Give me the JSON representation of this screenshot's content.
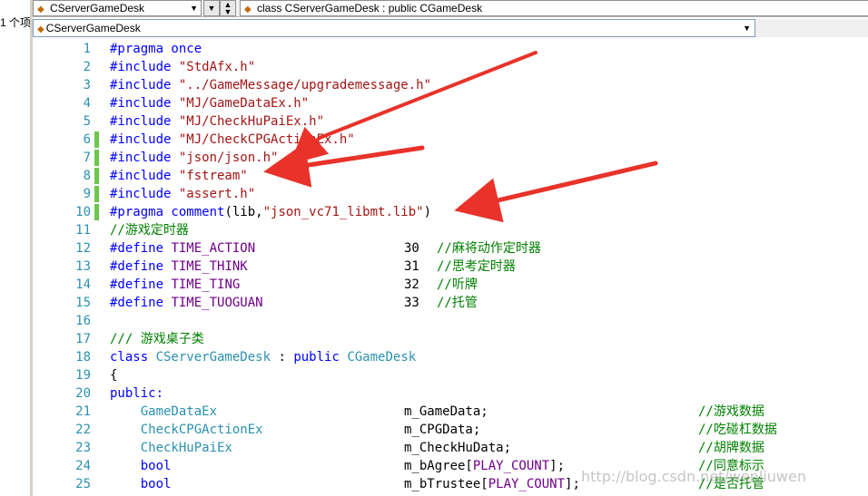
{
  "left_panel": {
    "text": "1 个项"
  },
  "topbar": {
    "class_combo": "CServerGameDesk",
    "member_combo": "class CServerGameDesk : public CGameDesk"
  },
  "navbar": {
    "scope": "CServerGameDesk"
  },
  "colors": {
    "keyword": "#0000ff",
    "string": "#a31515",
    "comment": "#008000",
    "macro": "#6f008a",
    "type": "#2b91af",
    "arrow": "#e8322a",
    "changed_marker": "#6cc84c"
  },
  "icons": {
    "class": "class-icon",
    "dropdown": "chevron-down-icon"
  },
  "editor": {
    "lines": [
      {
        "n": "1",
        "mark": "none",
        "parts": [
          {
            "t": "#pragma once",
            "c": "kw"
          }
        ]
      },
      {
        "n": "2",
        "mark": "none",
        "parts": [
          {
            "t": "#include ",
            "c": "kw"
          },
          {
            "t": "\"StdAfx.h\"",
            "c": "str"
          }
        ]
      },
      {
        "n": "3",
        "mark": "none",
        "parts": [
          {
            "t": "#include ",
            "c": "kw"
          },
          {
            "t": "\"../GameMessage/upgrademessage.h\"",
            "c": "str"
          }
        ]
      },
      {
        "n": "4",
        "mark": "none",
        "parts": [
          {
            "t": "#include ",
            "c": "kw"
          },
          {
            "t": "\"MJ/GameDataEx.h\"",
            "c": "str"
          }
        ]
      },
      {
        "n": "5",
        "mark": "none",
        "parts": [
          {
            "t": "#include ",
            "c": "kw"
          },
          {
            "t": "\"MJ/CheckHuPaiEx.h\"",
            "c": "str"
          }
        ]
      },
      {
        "n": "6",
        "mark": "changed",
        "parts": [
          {
            "t": "#include ",
            "c": "kw"
          },
          {
            "t": "\"MJ/CheckCPGActionEx.h\"",
            "c": "str"
          }
        ]
      },
      {
        "n": "7",
        "mark": "changed",
        "parts": [
          {
            "t": "#include ",
            "c": "kw"
          },
          {
            "t": "\"json/json.h\"",
            "c": "str"
          }
        ]
      },
      {
        "n": "8",
        "mark": "changed",
        "parts": [
          {
            "t": "#include ",
            "c": "kw"
          },
          {
            "t": "\"fstream\"",
            "c": "str"
          }
        ]
      },
      {
        "n": "9",
        "mark": "changed",
        "parts": [
          {
            "t": "#include ",
            "c": "kw"
          },
          {
            "t": "\"assert.h\"",
            "c": "str"
          }
        ]
      },
      {
        "n": "10",
        "mark": "changed",
        "parts": [
          {
            "t": "#pragma comment",
            "c": "kw"
          },
          {
            "t": "(lib,",
            "c": "plain"
          },
          {
            "t": "\"json_vc71_libmt.lib\"",
            "c": "str"
          },
          {
            "t": ")",
            "c": "plain"
          }
        ]
      },
      {
        "n": "11",
        "mark": "none",
        "parts": [
          {
            "t": "//游戏定时器",
            "c": "cm"
          }
        ]
      },
      {
        "n": "12",
        "mark": "none",
        "parts": [
          {
            "t": "#define ",
            "c": "kw"
          },
          {
            "t": "TIME_ACTION",
            "c": "mac"
          }
        ],
        "val": "30",
        "cmt": "//麻将动作定时器"
      },
      {
        "n": "13",
        "mark": "none",
        "parts": [
          {
            "t": "#define ",
            "c": "kw"
          },
          {
            "t": "TIME_THINK",
            "c": "mac"
          }
        ],
        "val": "31",
        "cmt": "//思考定时器"
      },
      {
        "n": "14",
        "mark": "none",
        "parts": [
          {
            "t": "#define ",
            "c": "kw"
          },
          {
            "t": "TIME_TING",
            "c": "mac"
          }
        ],
        "val": "32",
        "cmt": "//听牌"
      },
      {
        "n": "15",
        "mark": "none",
        "parts": [
          {
            "t": "#define ",
            "c": "kw"
          },
          {
            "t": "TIME_TUOGUAN",
            "c": "mac"
          }
        ],
        "val": "33",
        "cmt": "//托管"
      },
      {
        "n": "16",
        "mark": "none",
        "parts": []
      },
      {
        "n": "17",
        "mark": "none",
        "parts": [
          {
            "t": "/// 游戏桌子类",
            "c": "cm"
          }
        ]
      },
      {
        "n": "18",
        "mark": "none",
        "parts": [
          {
            "t": "class ",
            "c": "kw"
          },
          {
            "t": "CServerGameDesk",
            "c": "ty"
          },
          {
            "t": " : ",
            "c": "plain"
          },
          {
            "t": "public ",
            "c": "kw"
          },
          {
            "t": "CGameDesk",
            "c": "ty"
          }
        ]
      },
      {
        "n": "19",
        "mark": "none",
        "parts": [
          {
            "t": "{",
            "c": "plain"
          }
        ]
      },
      {
        "n": "20",
        "mark": "none",
        "parts": [
          {
            "t": "public:",
            "c": "kw"
          }
        ]
      },
      {
        "n": "21",
        "mark": "none",
        "parts": [
          {
            "t": "    GameDataEx",
            "c": "ty"
          }
        ],
        "member": [
          {
            "t": "m_GameData;",
            "c": "plain"
          }
        ],
        "cmt2": "//游戏数据"
      },
      {
        "n": "22",
        "mark": "none",
        "parts": [
          {
            "t": "    CheckCPGActionEx",
            "c": "ty"
          }
        ],
        "member": [
          {
            "t": "m_CPGData;",
            "c": "plain"
          }
        ],
        "cmt2": "//吃碰杠数据"
      },
      {
        "n": "23",
        "mark": "none",
        "parts": [
          {
            "t": "    CheckHuPaiEx",
            "c": "ty"
          }
        ],
        "member": [
          {
            "t": "m_CheckHuData;",
            "c": "plain"
          }
        ],
        "cmt2": "//胡牌数据"
      },
      {
        "n": "24",
        "mark": "none",
        "parts": [
          {
            "t": "    bool",
            "c": "kw"
          }
        ],
        "member": [
          {
            "t": "m_bAgree[",
            "c": "plain"
          },
          {
            "t": "PLAY_COUNT",
            "c": "mac"
          },
          {
            "t": "];",
            "c": "plain"
          }
        ],
        "cmt2": "//同意标示"
      },
      {
        "n": "25",
        "mark": "none",
        "parts": [
          {
            "t": "    bool",
            "c": "kw"
          }
        ],
        "member": [
          {
            "t": "m_bTrustee[",
            "c": "plain"
          },
          {
            "t": "PLAY_COUNT",
            "c": "mac"
          },
          {
            "t": "];",
            "c": "plain"
          }
        ],
        "cmt2": "//是否托管"
      }
    ]
  },
  "watermark": "http://blog.csdn.net/wenliuwen"
}
